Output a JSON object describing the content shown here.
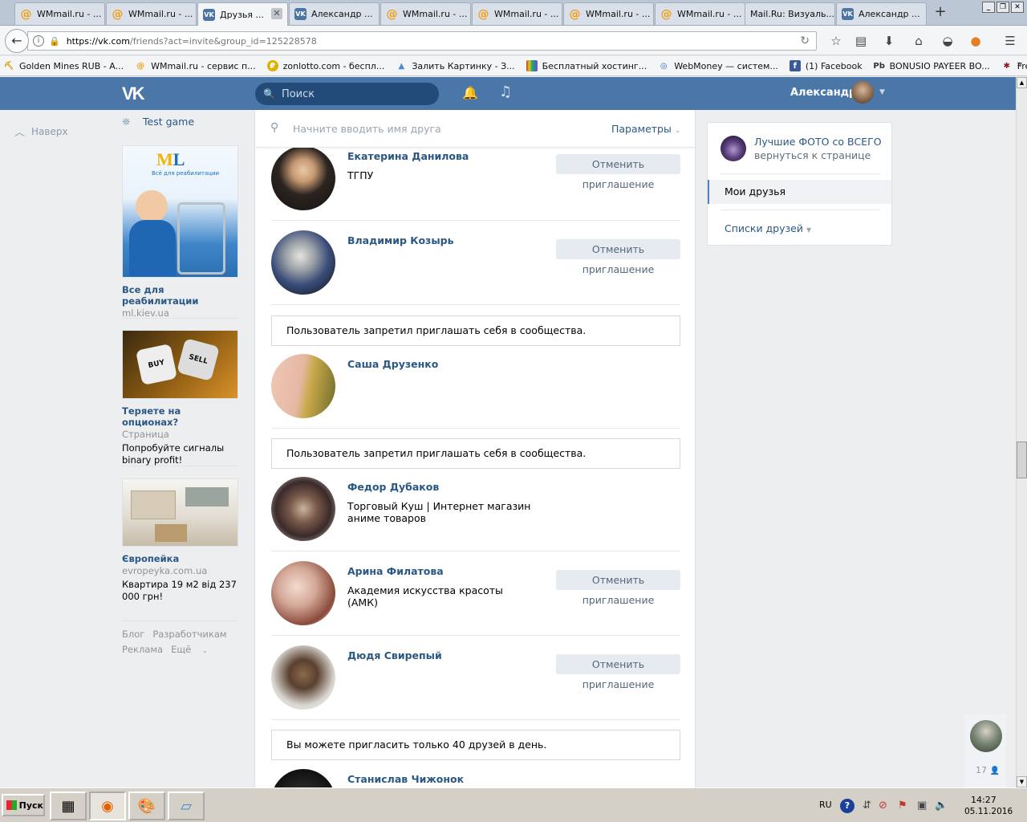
{
  "browser": {
    "tabs": [
      {
        "label": "WMmail.ru - ...",
        "icon": "wmmail-icon",
        "active": false
      },
      {
        "label": "WMmail.ru - ...",
        "icon": "wmmail-icon",
        "active": false
      },
      {
        "label": "Друзья ...",
        "icon": "vk-icon",
        "active": true
      },
      {
        "label": "Александр ...",
        "icon": "vk-icon",
        "active": false
      },
      {
        "label": "WMmail.ru - ...",
        "icon": "wmmail-icon",
        "active": false
      },
      {
        "label": "WMmail.ru - ...",
        "icon": "wmmail-icon",
        "active": false
      },
      {
        "label": "WMmail.ru - ...",
        "icon": "wmmail-icon",
        "active": false
      },
      {
        "label": "WMmail.ru - ...",
        "icon": "wmmail-icon",
        "active": false
      },
      {
        "label": "Mail.Ru: Визуаль...",
        "icon": "none",
        "active": false
      },
      {
        "label": "Александр ...",
        "icon": "vk-icon",
        "active": false
      }
    ],
    "new_tab_label": "+",
    "url_host": "https://vk.com",
    "url_path": "/friends?act=invite&group_id=125228578",
    "bookmarks": [
      {
        "label": "Golden Mines RUB - A...",
        "color": "#d89a00"
      },
      {
        "label": "WMmail.ru - сервис п...",
        "color": "#f39c12"
      },
      {
        "label": "zonlotto.com - беспл...",
        "color": "#e0b000"
      },
      {
        "label": "Залить Картинку - З...",
        "color": "#4a8ad4"
      },
      {
        "label": "Бесплатный хостинг...",
        "color": "#8e44ad"
      },
      {
        "label": "WebMoney — систем...",
        "color": "#2f6fbe"
      },
      {
        "label": "(1) Facebook",
        "color": "#3b5998"
      },
      {
        "label": "BONUSIO PAYEER BO...",
        "color": "#c0392b"
      },
      {
        "label": "FreeLotto.su | беспл...",
        "color": "#8b1a1a"
      }
    ],
    "bookmarks_more": "»"
  },
  "vk_header": {
    "logo": "VK",
    "search_placeholder": "Поиск",
    "user_name": "Александр"
  },
  "left_nav": {
    "back_to_top": "Наверх",
    "test_game": "Test game"
  },
  "ads": [
    {
      "title": "Все для реабилитации",
      "domain": "ml.kiev.ua",
      "desc": "",
      "brand": "Всё для реабилитации"
    },
    {
      "title": "Теряете на опционах?",
      "domain": "Страница",
      "desc": "Попробуйте сигналы binary profit!",
      "buy": "BUY",
      "sell": "SELL"
    },
    {
      "title": "Європейка",
      "domain": "evropeyka.com.ua",
      "desc": "Квартира 19 м2 від 237 000 грн!"
    }
  ],
  "footer": {
    "links": [
      "Блог",
      "Разработчикам",
      "Реклама",
      "Ещё"
    ]
  },
  "main": {
    "find_placeholder": "Начните вводить имя друга",
    "params_label": "Параметры",
    "cancel_label": "Отменить приглашение",
    "friends": [
      {
        "name": "Екатерина Данилова",
        "sub": "ТГПУ"
      },
      {
        "name": "Владимир Козырь",
        "sub": ""
      },
      {
        "name": "Саша Друзенко",
        "sub": ""
      },
      {
        "name": "Федор Дубаков",
        "sub": "Торговый Куш | Интернет магазин аниме товаров"
      },
      {
        "name": "Арина Филатова",
        "sub": "Академия искусства красоты (АМК)"
      },
      {
        "name": "Дюдя Свирепый",
        "sub": ""
      },
      {
        "name": "Станислав Чижонок",
        "sub": ""
      }
    ],
    "notice_banned": "Пользователь запретил приглашать себя в сообщества.",
    "notice_limit": "Вы можете пригласить только 40 друзей в день."
  },
  "right": {
    "group_name": "Лучшие ФОТО со ВСЕГО...",
    "back_link": "вернуться к странице",
    "my_friends": "Мои друзья",
    "friend_lists": "Списки друзей"
  },
  "chat": {
    "count": "17"
  },
  "taskbar": {
    "start": "Пуск",
    "lang": "RU",
    "time": "14:27",
    "date": "05.11.2016"
  }
}
